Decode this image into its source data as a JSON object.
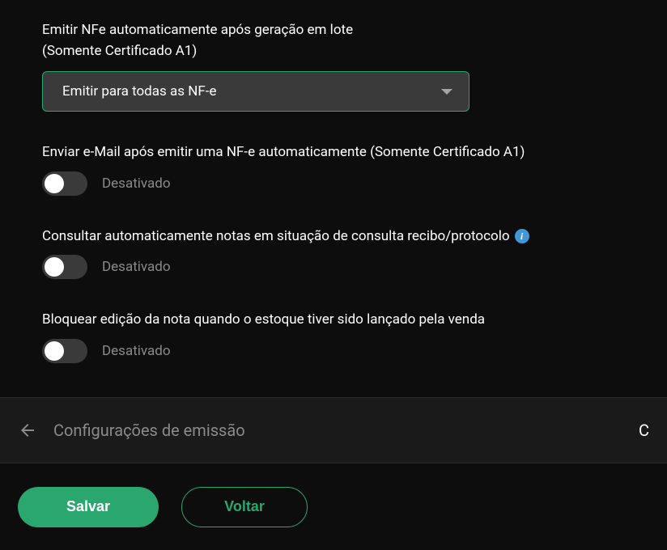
{
  "emit_nfe": {
    "label_line1": "Emitir NFe automaticamente após geração em lote",
    "label_line2": "(Somente Certificado A1)",
    "selected": "Emitir para todas as NF-e"
  },
  "send_email": {
    "label": "Enviar e-Mail após emitir uma NF-e automaticamente (Somente Certificado A1)",
    "status": "Desativado"
  },
  "auto_query": {
    "label": "Consultar automaticamente notas em situação de consulta recibo/protocolo",
    "status": "Desativado"
  },
  "block_edit": {
    "label": "Bloquear edição da nota quando o estoque tiver sido lançado pela venda",
    "status": "Desativado"
  },
  "nav": {
    "title": "Configurações de emissão",
    "right": "C"
  },
  "buttons": {
    "save": "Salvar",
    "back": "Voltar"
  },
  "info_glyph": "i"
}
